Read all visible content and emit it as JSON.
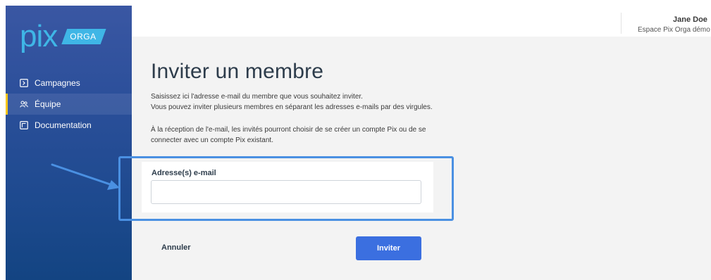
{
  "brand": {
    "logo_text": "pix",
    "logo_badge": "ORGA",
    "logo_color": "#3fb6e6"
  },
  "sidebar": {
    "items": [
      {
        "label": "Campagnes",
        "icon": "campaign-icon",
        "active": false
      },
      {
        "label": "Équipe",
        "icon": "team-icon",
        "active": true
      },
      {
        "label": "Documentation",
        "icon": "documentation-icon",
        "active": false
      }
    ],
    "active_indicator_color": "#f5c518"
  },
  "user": {
    "name": "Jane Doe",
    "space": "Espace Pix Orga démo"
  },
  "main": {
    "title": "Inviter un membre",
    "description_line1": "Saisissez ici l'adresse e-mail du membre que vous souhaitez inviter.",
    "description_line2": "Vous pouvez inviter plusieurs membres en séparant les adresses e-mails par des virgules.",
    "description_line3": "À la réception de l'e-mail, les invités pourront choisir de se créer un compte Pix ou de se",
    "description_line4": "connecter avec un compte Pix existant.",
    "email_label": "Adresse(s) e-mail",
    "email_value": "",
    "email_placeholder": "",
    "cancel_label": "Annuler",
    "invite_label": "Inviter"
  },
  "colors": {
    "primary_button": "#3b6fe0",
    "highlight": "#4a90e2"
  }
}
